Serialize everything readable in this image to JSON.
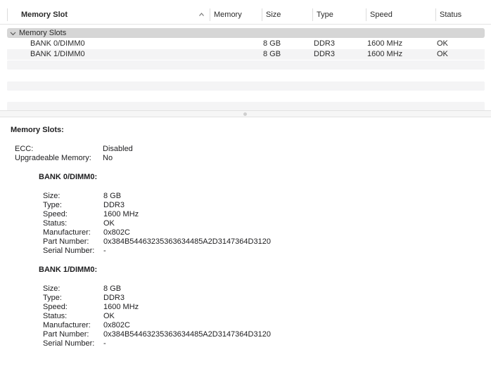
{
  "table": {
    "columns": [
      "Memory Slot",
      "Memory",
      "Size",
      "Type",
      "Speed",
      "Status"
    ],
    "group_label": "Memory Slots",
    "rows": [
      {
        "slot": "BANK 0/DIMM0",
        "memory": "",
        "size": "8 GB",
        "type": "DDR3",
        "speed": "1600 MHz",
        "status": "OK"
      },
      {
        "slot": "BANK 1/DIMM0",
        "memory": "",
        "size": "8 GB",
        "type": "DDR3",
        "speed": "1600 MHz",
        "status": "OK"
      }
    ]
  },
  "detail": {
    "title": "Memory Slots:",
    "summary": [
      {
        "label": "ECC:",
        "value": "Disabled"
      },
      {
        "label": "Upgradeable Memory:",
        "value": "No"
      }
    ],
    "banks": [
      {
        "title": "BANK 0/DIMM0:",
        "fields": [
          {
            "label": "Size:",
            "value": "8 GB"
          },
          {
            "label": "Type:",
            "value": "DDR3"
          },
          {
            "label": "Speed:",
            "value": "1600 MHz"
          },
          {
            "label": "Status:",
            "value": "OK"
          },
          {
            "label": "Manufacturer:",
            "value": "0x802C"
          },
          {
            "label": "Part Number:",
            "value": "0x384B54463235363634485A2D3147364D3120"
          },
          {
            "label": "Serial Number:",
            "value": "-"
          }
        ]
      },
      {
        "title": "BANK 1/DIMM0:",
        "fields": [
          {
            "label": "Size:",
            "value": "8 GB"
          },
          {
            "label": "Type:",
            "value": "DDR3"
          },
          {
            "label": "Speed:",
            "value": "1600 MHz"
          },
          {
            "label": "Status:",
            "value": "OK"
          },
          {
            "label": "Manufacturer:",
            "value": "0x802C"
          },
          {
            "label": "Part Number:",
            "value": "0x384B54463235363634485A2D3147364D3120"
          },
          {
            "label": "Serial Number:",
            "value": "-"
          }
        ]
      }
    ]
  },
  "icons": {
    "sort": "chevron-up-icon",
    "disclosure": "chevron-down-icon"
  },
  "colors": {
    "group_row": "#d6d6d6",
    "stripe": "#f4f4f5"
  }
}
